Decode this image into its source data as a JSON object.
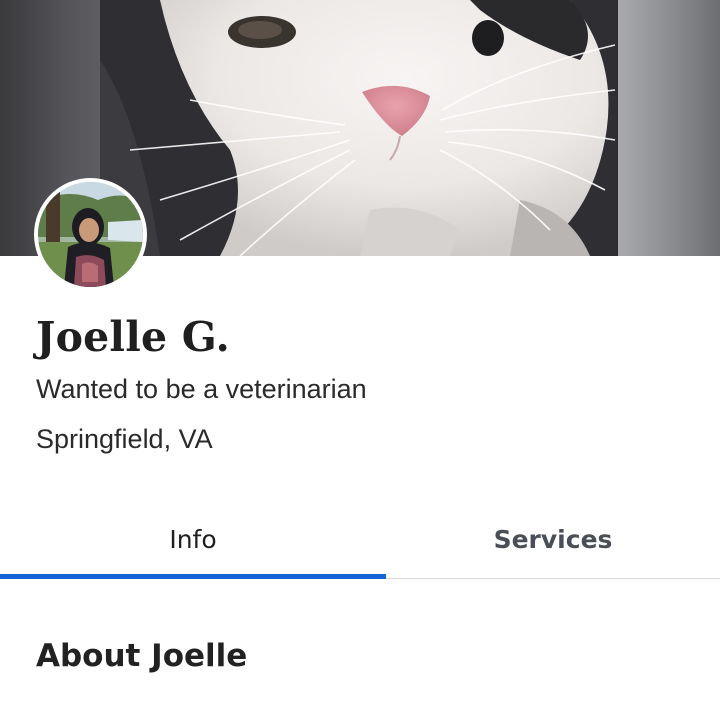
{
  "profile": {
    "name": "Joelle G.",
    "tagline": "Wanted to be a veterinarian",
    "location": "Springfield, VA"
  },
  "media": {
    "cover_photo": "white-cat-photo",
    "avatar_photo": "profile-photo"
  },
  "tabs": [
    {
      "label": "Info",
      "active": true
    },
    {
      "label": "Services",
      "active": false
    }
  ],
  "about": {
    "heading": "About Joelle",
    "body": ""
  },
  "colors": {
    "accent": "#1565d8",
    "text_primary": "#1f1f1f",
    "text_secondary": "#4a4f57",
    "divider": "#d9d9d9"
  }
}
